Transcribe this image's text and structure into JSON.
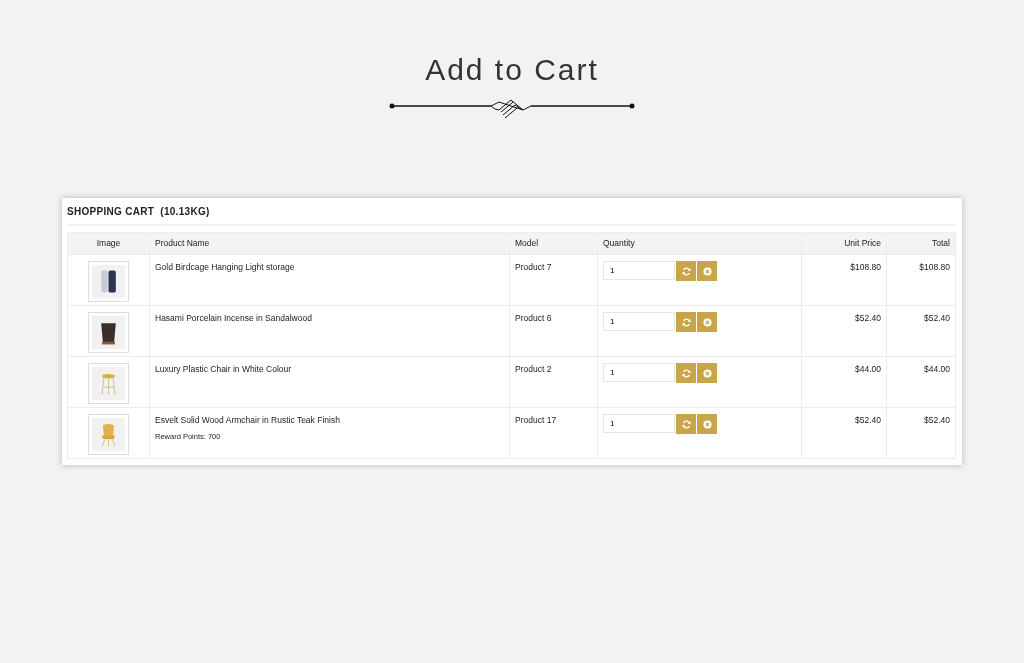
{
  "heading": {
    "title": "Add to Cart"
  },
  "cart": {
    "title": "SHOPPING CART",
    "weight": "(10.13KG)",
    "columns": [
      "Image",
      "Product Name",
      "Model",
      "Quantity",
      "Unit Price",
      "Total"
    ],
    "rows": [
      {
        "kind": "bottle",
        "name": "Gold Birdcage Hanging Light storage",
        "model": "Product 7",
        "quantity": "1",
        "unit_price": "$108.80",
        "total": "$108.80"
      },
      {
        "kind": "vase",
        "name": "Hasami Porcelain Incense in Sandalwood",
        "model": "Product 6",
        "quantity": "1",
        "unit_price": "$52.40",
        "total": "$52.40"
      },
      {
        "kind": "stool",
        "name": "Luxury Plastic Chair in White Colour",
        "model": "Product 2",
        "quantity": "1",
        "unit_price": "$44.00",
        "total": "$44.00"
      },
      {
        "kind": "chair",
        "name": "Esvelt Solid Wood Armchair in Rustic Teak Finish",
        "reward": "Reward Points: 700",
        "model": "Product 17",
        "quantity": "1",
        "unit_price": "$52.40",
        "total": "$52.40"
      }
    ]
  }
}
